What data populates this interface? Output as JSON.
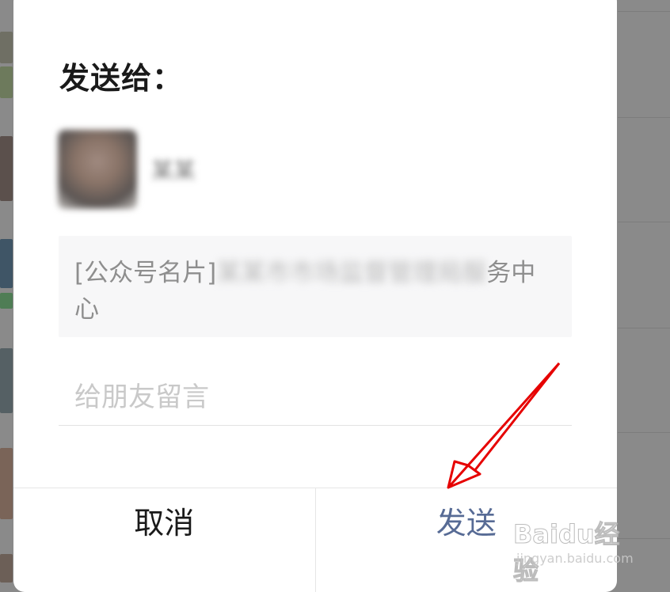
{
  "dialog": {
    "title": "发送给：",
    "recipient": {
      "name": "某某"
    },
    "card_preview": {
      "prefix": "[公众号名片]",
      "name_blurred": "某某市市场监督管理局服",
      "name_tail": "务中心"
    },
    "message": {
      "placeholder": "给朋友留言",
      "value": ""
    },
    "buttons": {
      "cancel": "取消",
      "send": "发送"
    }
  },
  "watermark": {
    "logo": "Baidu经验",
    "sub": "jingyan.baidu.com"
  },
  "colors": {
    "send_accent": "#576b95",
    "annotation_arrow": "#ff0000"
  }
}
